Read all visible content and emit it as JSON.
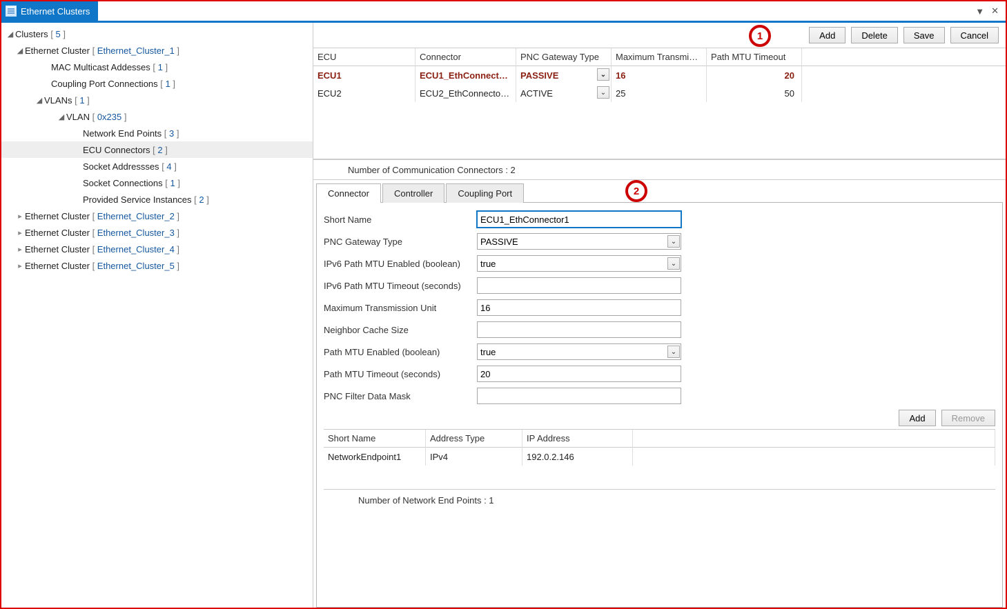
{
  "window": {
    "title": "Ethernet Clusters"
  },
  "callouts": {
    "one": "1",
    "two": "2"
  },
  "toolbar": {
    "add": "Add",
    "delete": "Delete",
    "save": "Save",
    "cancel": "Cancel"
  },
  "tree": {
    "root_label": "Clusters",
    "root_count": "5",
    "items": [
      {
        "label": "Ethernet Cluster",
        "link": "Ethernet_Cluster_1",
        "expanded": true,
        "children": [
          {
            "label": "MAC Multicast Addesses",
            "count": "1"
          },
          {
            "label": "Coupling Port Connections",
            "count": "1"
          },
          {
            "label": "VLANs",
            "count": "1",
            "expanded": true,
            "children": [
              {
                "label": "VLAN",
                "link": "0x235",
                "expanded": true,
                "children": [
                  {
                    "label": "Network End Points",
                    "count": "3"
                  },
                  {
                    "label": "ECU Connectors",
                    "count": "2",
                    "selected": true
                  },
                  {
                    "label": "Socket Addressses",
                    "count": "4"
                  },
                  {
                    "label": "Socket Connections",
                    "count": "1"
                  },
                  {
                    "label": "Provided Service Instances",
                    "count": "2"
                  }
                ]
              }
            ]
          }
        ]
      },
      {
        "label": "Ethernet Cluster",
        "link": "Ethernet_Cluster_2"
      },
      {
        "label": "Ethernet Cluster",
        "link": "Ethernet_Cluster_3"
      },
      {
        "label": "Ethernet Cluster",
        "link": "Ethernet_Cluster_4"
      },
      {
        "label": "Ethernet Cluster",
        "link": "Ethernet_Cluster_5"
      }
    ]
  },
  "grid": {
    "headers": {
      "ecu": "ECU",
      "connector": "Connector",
      "pnc": "PNC Gateway Type",
      "mtu": "Maximum Transmi…",
      "pmt": "Path MTU Timeout"
    },
    "rows": [
      {
        "ecu": "ECU1",
        "connector": "ECU1_EthConnect…",
        "pnc": "PASSIVE",
        "mtu": "16",
        "pmt": "20",
        "selected": true
      },
      {
        "ecu": "ECU2",
        "connector": "ECU2_EthConnecto…",
        "pnc": "ACTIVE",
        "mtu": "25",
        "pmt": "50",
        "selected": false
      }
    ],
    "status": "Number of Communication Connectors : 2"
  },
  "tabs": {
    "connector": "Connector",
    "controller": "Controller",
    "coupling": "Coupling Port"
  },
  "form": {
    "short_name_label": "Short Name",
    "short_name_value": "ECU1_EthConnector1",
    "pnc_label": "PNC Gateway Type",
    "pnc_value": "PASSIVE",
    "ipv6_enabled_label": "IPv6 Path MTU Enabled (boolean)",
    "ipv6_enabled_value": "true",
    "ipv6_timeout_label": "IPv6 Path MTU Timeout (seconds)",
    "ipv6_timeout_value": "",
    "mtu_label": "Maximum Transmission Unit",
    "mtu_value": "16",
    "ncs_label": "Neighbor Cache Size",
    "ncs_value": "",
    "pmte_label": "Path MTU Enabled (boolean)",
    "pmte_value": "true",
    "pmtt_label": "Path MTU Timeout (seconds)",
    "pmtt_value": "20",
    "pfdm_label": "PNC Filter Data Mask",
    "pfdm_value": ""
  },
  "sub_toolbar": {
    "add": "Add",
    "remove": "Remove"
  },
  "sub_grid": {
    "headers": {
      "name": "Short Name",
      "type": "Address Type",
      "ip": "IP Address"
    },
    "rows": [
      {
        "name": "NetworkEndpoint1",
        "type": "IPv4",
        "ip": "192.0.2.146"
      }
    ],
    "status": "Number of Network End Points : 1"
  }
}
